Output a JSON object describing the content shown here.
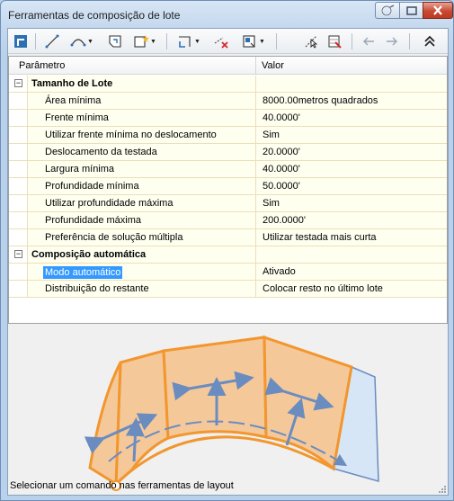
{
  "window": {
    "title": "Ferramentas de composição de lote"
  },
  "grid": {
    "headers": {
      "param": "Parâmetro",
      "value": "Valor"
    },
    "categories": [
      {
        "label": "Tamanho de Lote",
        "expander": "−",
        "rows": [
          {
            "label": "Área mínima",
            "value": "8000.00metros quadrados"
          },
          {
            "label": "Frente mínima",
            "value": "40.0000'"
          },
          {
            "label": "Utilizar frente mínima no deslocamento",
            "value": "Sim"
          },
          {
            "label": "Deslocamento da testada",
            "value": "20.0000'"
          },
          {
            "label": "Largura mínima",
            "value": "40.0000'"
          },
          {
            "label": "Profundidade mínima",
            "value": "50.0000'"
          },
          {
            "label": "Utilizar profundidade máxima",
            "value": "Sim"
          },
          {
            "label": "Profundidade máxima",
            "value": "200.0000'"
          },
          {
            "label": "Preferência de solução múltipla",
            "value": "Utilizar testada mais curta"
          }
        ]
      },
      {
        "label": "Composição automática",
        "expander": "−",
        "rows": [
          {
            "label": "Modo automático",
            "value": "Ativado",
            "selected": true
          },
          {
            "label": "Distribuição do restante",
            "value": "Colocar resto no último lote"
          }
        ]
      }
    ]
  },
  "status": "Selecionar um comando nas ferramentas de layout",
  "colors": {
    "lot_fill": "#f5c89a",
    "lot_outline": "#f2962e",
    "remainder_fill": "#d6e6f7",
    "arrow": "#6b8cbf",
    "selection": "#3399ff"
  }
}
